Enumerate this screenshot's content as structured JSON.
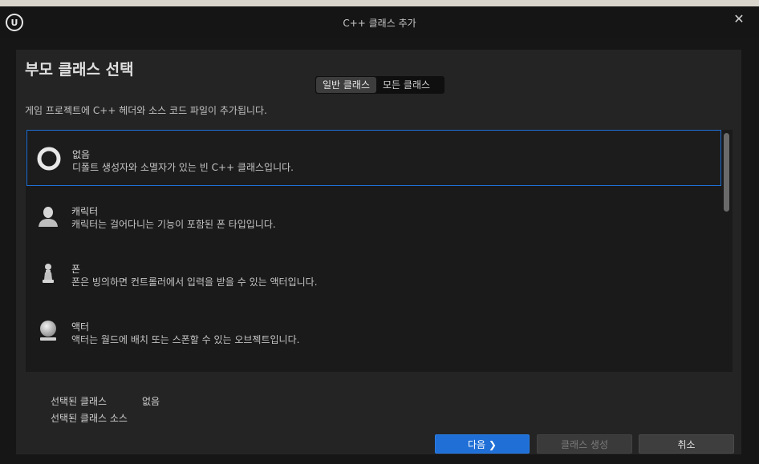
{
  "window": {
    "title": "C++ 클래스 추가",
    "logo_text": "U"
  },
  "panel": {
    "heading": "부모 클래스 선택",
    "tabs": [
      {
        "label": "일반 클래스",
        "active": true
      },
      {
        "label": "모든 클래스",
        "active": false
      }
    ],
    "description": "게임 프로젝트에 C++ 헤더와 소스 코드 파일이 추가됩니다."
  },
  "classes": [
    {
      "name": "없음",
      "description": "디폴트 생성자와 소멸자가 있는 빈 C++ 클래스입니다.",
      "icon": "none-ring-icon",
      "selected": true
    },
    {
      "name": "캐릭터",
      "description": "캐릭터는 걸어다니는 기능이 포함된 폰 타입입니다.",
      "icon": "character-icon",
      "selected": false
    },
    {
      "name": "폰",
      "description": "폰은 빙의하면 컨트롤러에서 입력을 받을 수 있는 액터입니다.",
      "icon": "pawn-icon",
      "selected": false
    },
    {
      "name": "액터",
      "description": "액터는 월드에 배치 또는 스폰할 수 있는 오브젝트입니다.",
      "icon": "actor-sphere-icon",
      "selected": false
    }
  ],
  "selection": {
    "selected_class_label": "선택된 클래스",
    "selected_class_value": "없음",
    "selected_source_label": "선택된 클래스 소스"
  },
  "buttons": {
    "next": "다음 ❯",
    "create": "클래스 생성",
    "cancel": "취소"
  },
  "colors": {
    "accent": "#1f6fd6",
    "background": "#161616",
    "panel": "#242424"
  }
}
